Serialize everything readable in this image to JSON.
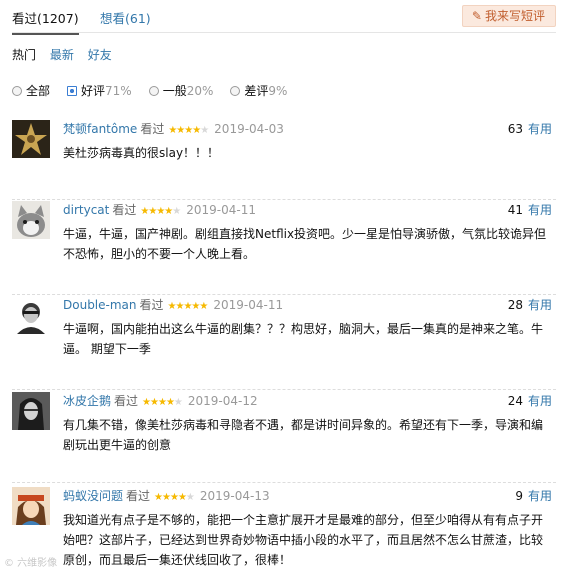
{
  "tabs": {
    "seen": "看过(1207)",
    "want": "想看(61)"
  },
  "write_button": {
    "icon": "pencil-icon",
    "label": "我来写短评"
  },
  "sort": {
    "hot": "热门",
    "latest": "最新",
    "friends": "好友"
  },
  "filter": {
    "all": "全部",
    "good": "好评",
    "good_pct": "71%",
    "mid": "一般",
    "mid_pct": "20%",
    "bad": "差评",
    "bad_pct": "9%",
    "selected": "good"
  },
  "comments": [
    {
      "user": "梵顿fantôme",
      "status": "看过",
      "rating": 4,
      "date": "2019-04-03",
      "votes": "63",
      "useful": "有用",
      "text": "美杜莎病毒真的很slay！！！"
    },
    {
      "user": "dirtycat",
      "status": "看过",
      "rating": 4,
      "date": "2019-04-11",
      "votes": "41",
      "useful": "有用",
      "text": "牛逼，牛逼，国产神剧。剧组直接找Netflix投资吧。少一星是怕导演骄傲，气氛比较诡异但不恐怖，胆小的不要一个人晚上看。"
    },
    {
      "user": "Double-man",
      "status": "看过",
      "rating": 5,
      "date": "2019-04-11",
      "votes": "28",
      "useful": "有用",
      "text": "牛逼啊，国内能拍出这么牛逼的剧集？？？构思好，脑洞大，最后一集真的是神来之笔。牛逼。 期望下一季"
    },
    {
      "user": "冰皮企鹅",
      "status": "看过",
      "rating": 4,
      "date": "2019-04-12",
      "votes": "24",
      "useful": "有用",
      "text": "有几集不错，像美杜莎病毒和寻隐者不遇，都是讲时间异象的。希望还有下一季，导演和编剧玩出更牛逼的创意"
    },
    {
      "user": "蚂蚁没问题",
      "status": "看过",
      "rating": 4,
      "date": "2019-04-13",
      "votes": "9",
      "useful": "有用",
      "text": "我知道光有点子是不够的，能把一个主意扩展开才是最难的部分，但至少咱得从有有点子开始吧？这部片子，已经达到世界奇妙物语中插小段的水平了，而且居然不怎么甘蔗渣，比较原创，而且最后一集还伏线回收了，很棒！"
    }
  ],
  "watermark": "© 六维影像"
}
